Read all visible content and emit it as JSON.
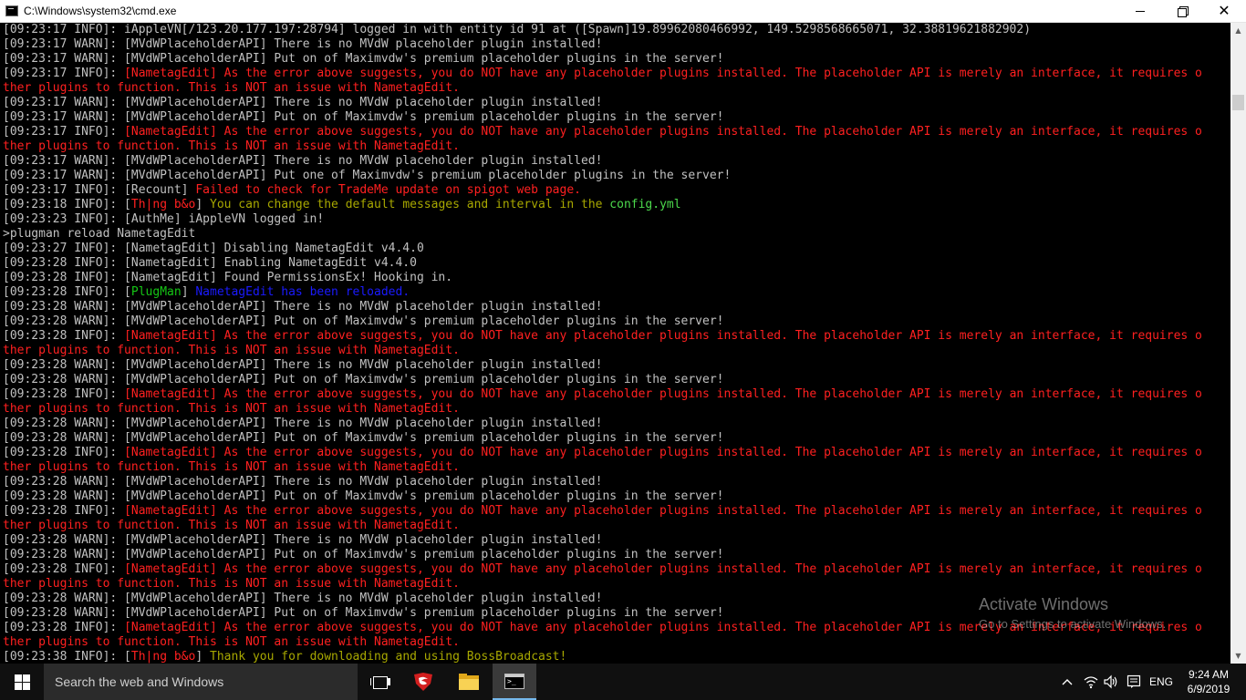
{
  "window": {
    "title": "C:\\Windows\\system32\\cmd.exe",
    "minimize_label": "—",
    "close_label": "✕"
  },
  "console": {
    "lines": [
      [
        {
          "t": "[09:23:17 INFO]: iAppleVN[/123.20.177.197:28794] logged in with entity id 91 at ([Spawn]19.89962080466992, 149.5298568665071, 32.38819621882902)",
          "c": ""
        }
      ],
      [
        {
          "t": "[09:23:17 WARN]: [MVdWPlaceholderAPI] There is no MVdW placeholder plugin installed!",
          "c": ""
        }
      ],
      [
        {
          "t": "[09:23:17 WARN]: [MVdWPlaceholderAPI] Put on of Maximvdw's premium placeholder plugins in the server!",
          "c": ""
        }
      ],
      [
        {
          "t": "[09:23:17 INFO]: ",
          "c": ""
        },
        {
          "t": "[NametagEdit] As the error above suggests, you do NOT have any placeholder plugins installed. The placeholder API is merely an interface, it requires o",
          "c": "red"
        }
      ],
      [
        {
          "t": "ther plugins to function. This is NOT an issue with NametagEdit.",
          "c": "red"
        }
      ],
      [
        {
          "t": "[09:23:17 WARN]: [MVdWPlaceholderAPI] There is no MVdW placeholder plugin installed!",
          "c": ""
        }
      ],
      [
        {
          "t": "[09:23:17 WARN]: [MVdWPlaceholderAPI] Put on of Maximvdw's premium placeholder plugins in the server!",
          "c": ""
        }
      ],
      [
        {
          "t": "[09:23:17 INFO]: ",
          "c": ""
        },
        {
          "t": "[NametagEdit] As the error above suggests, you do NOT have any placeholder plugins installed. The placeholder API is merely an interface, it requires o",
          "c": "red"
        }
      ],
      [
        {
          "t": "ther plugins to function. This is NOT an issue with NametagEdit.",
          "c": "red"
        }
      ],
      [
        {
          "t": "[09:23:17 WARN]: [MVdWPlaceholderAPI] There is no MVdW placeholder plugin installed!",
          "c": ""
        }
      ],
      [
        {
          "t": "[09:23:17 WARN]: [MVdWPlaceholderAPI] Put one of Maximvdw's premium placeholder plugins in the server!",
          "c": ""
        }
      ],
      [
        {
          "t": "[09:23:17 INFO]: [Recount] ",
          "c": ""
        },
        {
          "t": "Failed to check for TradeMe update on spigot web page.",
          "c": "red"
        }
      ],
      [
        {
          "t": "[09:23:18 INFO]: [",
          "c": ""
        },
        {
          "t": "Th|ng b&o",
          "c": "red"
        },
        {
          "t": "] ",
          "c": ""
        },
        {
          "t": "You can change the default messages and interval in the ",
          "c": "yellow"
        },
        {
          "t": "config.yml",
          "c": "brightgreen"
        }
      ],
      [
        {
          "t": "[09:23:23 INFO]: [AuthMe] iAppleVN logged in!",
          "c": ""
        }
      ],
      [
        {
          "t": ">plugman reload NametagEdit",
          "c": ""
        }
      ],
      [
        {
          "t": "[09:23:27 INFO]: [NametagEdit] Disabling NametagEdit v4.4.0",
          "c": ""
        }
      ],
      [
        {
          "t": "[09:23:28 INFO]: [NametagEdit] Enabling NametagEdit v4.4.0",
          "c": ""
        }
      ],
      [
        {
          "t": "[09:23:28 INFO]: [NametagEdit] Found PermissionsEx! Hooking in.",
          "c": ""
        }
      ],
      [
        {
          "t": "[09:23:28 INFO]: [",
          "c": ""
        },
        {
          "t": "PlugMan",
          "c": "green"
        },
        {
          "t": "] ",
          "c": ""
        },
        {
          "t": "NametagEdit has been reloaded.",
          "c": "blue"
        }
      ],
      [
        {
          "t": "[09:23:28 WARN]: [MVdWPlaceholderAPI] There is no MVdW placeholder plugin installed!",
          "c": ""
        }
      ],
      [
        {
          "t": "[09:23:28 WARN]: [MVdWPlaceholderAPI] Put on of Maximvdw's premium placeholder plugins in the server!",
          "c": ""
        }
      ],
      [
        {
          "t": "[09:23:28 INFO]: ",
          "c": ""
        },
        {
          "t": "[NametagEdit] As the error above suggests, you do NOT have any placeholder plugins installed. The placeholder API is merely an interface, it requires o",
          "c": "red"
        }
      ],
      [
        {
          "t": "ther plugins to function. This is NOT an issue with NametagEdit.",
          "c": "red"
        }
      ],
      [
        {
          "t": "[09:23:28 WARN]: [MVdWPlaceholderAPI] There is no MVdW placeholder plugin installed!",
          "c": ""
        }
      ],
      [
        {
          "t": "[09:23:28 WARN]: [MVdWPlaceholderAPI] Put on of Maximvdw's premium placeholder plugins in the server!",
          "c": ""
        }
      ],
      [
        {
          "t": "[09:23:28 INFO]: ",
          "c": ""
        },
        {
          "t": "[NametagEdit] As the error above suggests, you do NOT have any placeholder plugins installed. The placeholder API is merely an interface, it requires o",
          "c": "red"
        }
      ],
      [
        {
          "t": "ther plugins to function. This is NOT an issue with NametagEdit.",
          "c": "red"
        }
      ],
      [
        {
          "t": "[09:23:28 WARN]: [MVdWPlaceholderAPI] There is no MVdW placeholder plugin installed!",
          "c": ""
        }
      ],
      [
        {
          "t": "[09:23:28 WARN]: [MVdWPlaceholderAPI] Put on of Maximvdw's premium placeholder plugins in the server!",
          "c": ""
        }
      ],
      [
        {
          "t": "[09:23:28 INFO]: ",
          "c": ""
        },
        {
          "t": "[NametagEdit] As the error above suggests, you do NOT have any placeholder plugins installed. The placeholder API is merely an interface, it requires o",
          "c": "red"
        }
      ],
      [
        {
          "t": "ther plugins to function. This is NOT an issue with NametagEdit.",
          "c": "red"
        }
      ],
      [
        {
          "t": "[09:23:28 WARN]: [MVdWPlaceholderAPI] There is no MVdW placeholder plugin installed!",
          "c": ""
        }
      ],
      [
        {
          "t": "[09:23:28 WARN]: [MVdWPlaceholderAPI] Put on of Maximvdw's premium placeholder plugins in the server!",
          "c": ""
        }
      ],
      [
        {
          "t": "[09:23:28 INFO]: ",
          "c": ""
        },
        {
          "t": "[NametagEdit] As the error above suggests, you do NOT have any placeholder plugins installed. The placeholder API is merely an interface, it requires o",
          "c": "red"
        }
      ],
      [
        {
          "t": "ther plugins to function. This is NOT an issue with NametagEdit.",
          "c": "red"
        }
      ],
      [
        {
          "t": "[09:23:28 WARN]: [MVdWPlaceholderAPI] There is no MVdW placeholder plugin installed!",
          "c": ""
        }
      ],
      [
        {
          "t": "[09:23:28 WARN]: [MVdWPlaceholderAPI] Put on of Maximvdw's premium placeholder plugins in the server!",
          "c": ""
        }
      ],
      [
        {
          "t": "[09:23:28 INFO]: ",
          "c": ""
        },
        {
          "t": "[NametagEdit] As the error above suggests, you do NOT have any placeholder plugins installed. The placeholder API is merely an interface, it requires o",
          "c": "red"
        }
      ],
      [
        {
          "t": "ther plugins to function. This is NOT an issue with NametagEdit.",
          "c": "red"
        }
      ],
      [
        {
          "t": "[09:23:28 WARN]: [MVdWPlaceholderAPI] There is no MVdW placeholder plugin installed!",
          "c": ""
        }
      ],
      [
        {
          "t": "[09:23:28 WARN]: [MVdWPlaceholderAPI] Put on of Maximvdw's premium placeholder plugins in the server!",
          "c": ""
        }
      ],
      [
        {
          "t": "[09:23:28 INFO]: ",
          "c": ""
        },
        {
          "t": "[NametagEdit] As the error above suggests, you do NOT have any placeholder plugins installed. The placeholder API is merely an interface, it requires o",
          "c": "red"
        }
      ],
      [
        {
          "t": "ther plugins to function. This is NOT an issue with NametagEdit.",
          "c": "red"
        }
      ],
      [
        {
          "t": "[09:23:38 INFO]: [",
          "c": ""
        },
        {
          "t": "Th|ng b&o",
          "c": "red"
        },
        {
          "t": "] ",
          "c": ""
        },
        {
          "t": "Thank you for downloading and using BossBroadcast!",
          "c": "yellow"
        }
      ]
    ]
  },
  "colors": {
    "red": "#ff2020",
    "green": "#15c615",
    "blue": "#1a1aff",
    "yellow": "#a8a800",
    "brightgreen": "#4cd94c",
    "default": "#c0c0c0"
  },
  "watermark": {
    "title": "Activate Windows",
    "subtitle": "Go to Settings to activate Windows."
  },
  "taskbar": {
    "search_placeholder": "Search the web and Windows",
    "language": "ENG",
    "time": "9:24 AM",
    "date": "6/9/2019",
    "apps": [
      "task-view-icon",
      "garena-icon",
      "file-explorer-icon",
      "cmd-icon"
    ]
  }
}
